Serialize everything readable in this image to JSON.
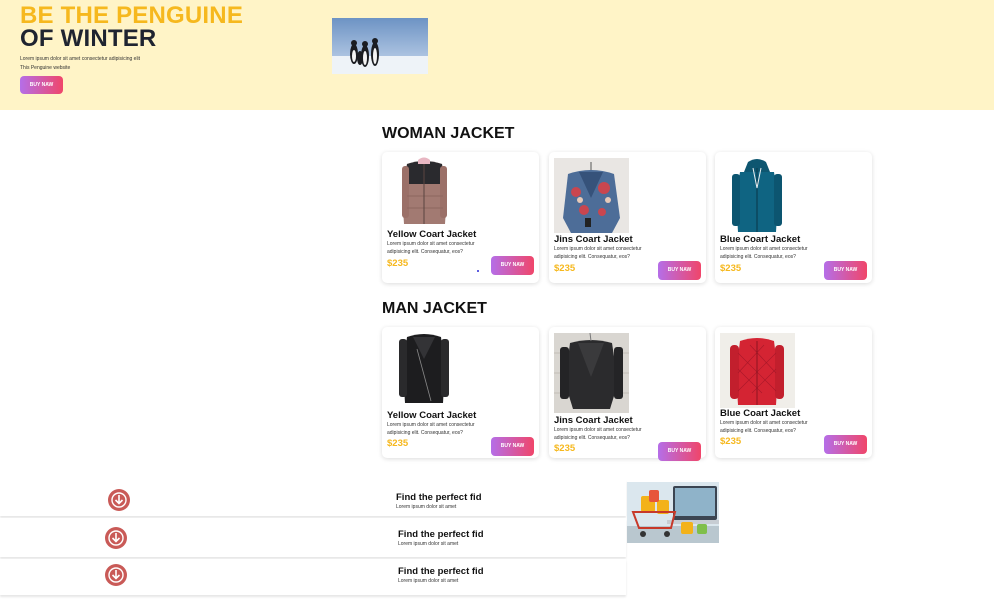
{
  "hero": {
    "title_line1": "BE THE PENGUINE",
    "title_line2": "OF WINTER",
    "text": "Lorem ipsum dolor sit amet consectetur adipisicing elit This Penguine website",
    "button": "BUY NAW",
    "image_icon": "penguins-photo"
  },
  "woman": {
    "title": "WOMAN JACKET",
    "products": [
      {
        "name": "Yellow Coart Jacket",
        "desc": "Lorem ipsum dolor sit amet consectetur adipisicing elit. Consequatur, eos?",
        "price": "$235",
        "button": "BUY NAW",
        "image_icon": "puffer-jacket-photo"
      },
      {
        "name": "Jins Coart Jacket",
        "desc": "Lorem ipsum dolor sit amet consectetur adipisicing elit. Consequatur, eos?",
        "price": "$235",
        "button": "BUY NAW",
        "image_icon": "denim-jacket-photo"
      },
      {
        "name": "Blue Coart Jacket",
        "desc": "Lorem ipsum dolor sit amet consectetur adipisicing elit. Consequatur, eos?",
        "price": "$235",
        "button": "BUY NAW",
        "image_icon": "blue-hoodie-jacket-photo"
      }
    ]
  },
  "man": {
    "title": "MAN JACKET",
    "products": [
      {
        "name": "Yellow Coart Jacket",
        "desc": "Lorem ipsum dolor sit amet consectetur adipisicing elit. Consequatur, eos?",
        "price": "$235",
        "button": "BUY NAW",
        "image_icon": "leather-biker-jacket-photo"
      },
      {
        "name": "Jins Coart Jacket",
        "desc": "Lorem ipsum dolor sit amet consectetur adipisicing elit. Consequatur, eos?",
        "price": "$235",
        "button": "BUY NAW",
        "image_icon": "leather-jacket-photo"
      },
      {
        "name": "Blue Coart Jacket",
        "desc": "Lorem ipsum dolor sit amet consectetur adipisicing elit. Consequatur, eos?",
        "price": "$235",
        "button": "BUY NAW",
        "image_icon": "red-quilted-jacket-photo"
      }
    ]
  },
  "features": [
    {
      "title": "Find the perfect fid",
      "sub": "Lorem ipsum dolor sit amet",
      "icon": "download-icon"
    },
    {
      "title": "Find the perfect fid",
      "sub": "Lorem ipsum dolor sit amet",
      "icon": "download-icon"
    },
    {
      "title": "Find the perfect fid",
      "sub": "Lorem ipsum dolor sit amet",
      "icon": "download-icon"
    }
  ],
  "feature_image_icon": "shopping-cart-photo",
  "colors": {
    "hero_bg": "#fff4c7",
    "accent_yellow": "#f6b81e",
    "dark_text": "#1f2430",
    "button_gradient_start": "#b56ee8",
    "button_gradient_end": "#f0466a",
    "feature_icon": "#c95a57"
  }
}
